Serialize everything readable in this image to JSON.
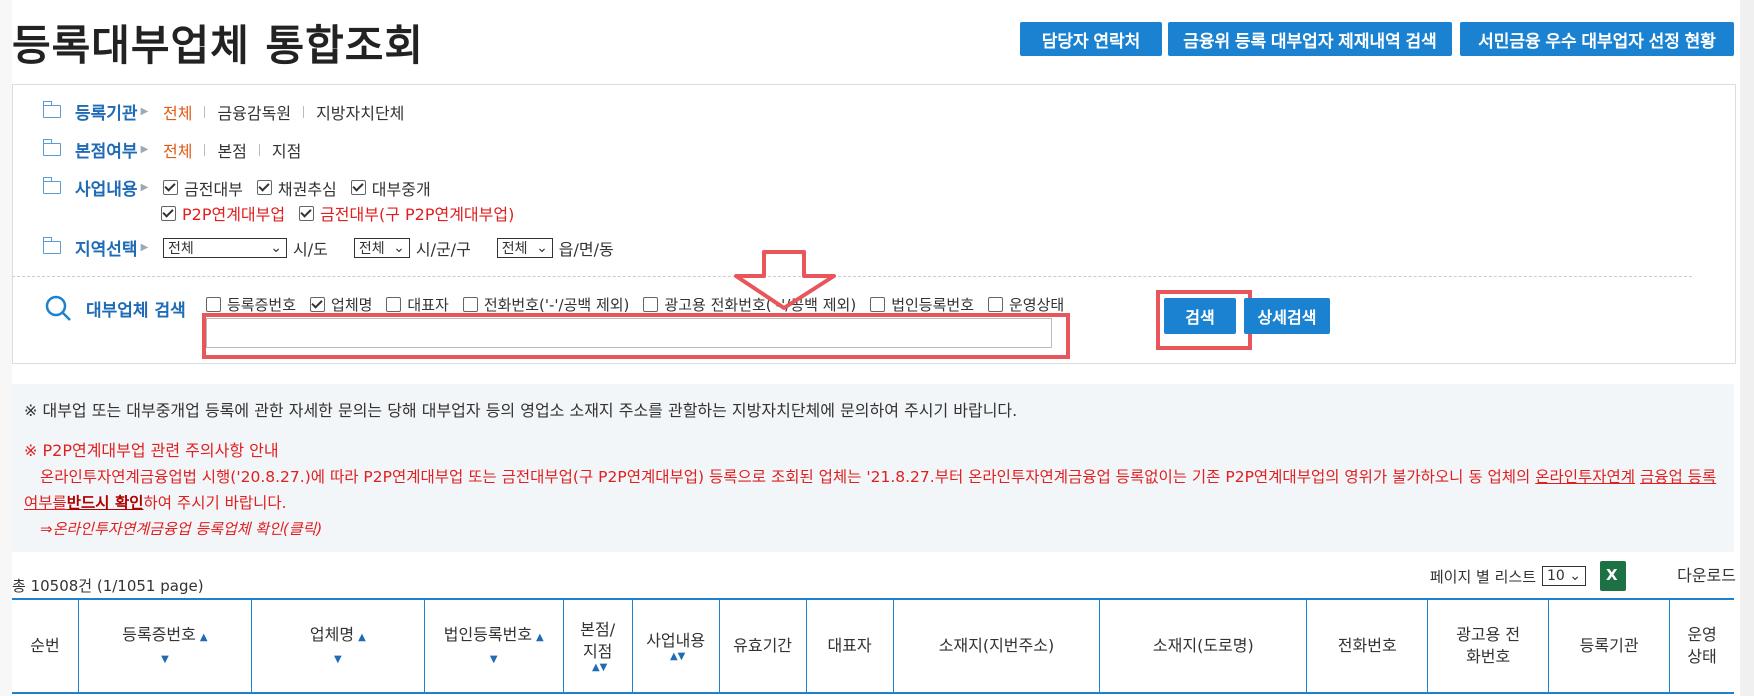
{
  "page": {
    "title": "등록대부업체 통합조회"
  },
  "top_buttons": [
    "담당자 연락처",
    "금융위 등록 대부업자 제재내역 검색",
    "서민금융 우수 대부업자 선정 현황"
  ],
  "filters": {
    "agency": {
      "label": "등록기관",
      "options": [
        "전체",
        "금융감독원",
        "지방자치단체"
      ],
      "selected": "전체"
    },
    "branch": {
      "label": "본점여부",
      "options": [
        "전체",
        "본점",
        "지점"
      ],
      "selected": "전체"
    },
    "business": {
      "label": "사업내용",
      "items": [
        {
          "label": "금전대부",
          "checked": true,
          "red": false
        },
        {
          "label": "채권추심",
          "checked": true,
          "red": false
        },
        {
          "label": "대부중개",
          "checked": true,
          "red": false
        },
        {
          "label": "P2P연계대부업",
          "checked": true,
          "red": true
        },
        {
          "label": "금전대부(구 P2P연계대부업)",
          "checked": true,
          "red": true
        }
      ]
    },
    "region": {
      "label": "지역선택",
      "sido_value": "전체",
      "sido_unit": "시/도",
      "sigungu_value": "전체",
      "sigungu_unit": "시/군/구",
      "eup_value": "전체",
      "eup_unit": "읍/면/동"
    }
  },
  "search": {
    "label": "대부업체 검색",
    "options": [
      {
        "label": "등록증번호",
        "checked": false
      },
      {
        "label": "업체명",
        "checked": true
      },
      {
        "label": "대표자",
        "checked": false
      },
      {
        "label": "전화번호('-'/공백 제외)",
        "checked": false
      },
      {
        "label": "광고용 전화번호('-'/공백 제외)",
        "checked": false
      },
      {
        "label": "법인등록번호",
        "checked": false
      },
      {
        "label": "운영상태",
        "checked": false
      }
    ],
    "input_value": "",
    "search_button": "검색",
    "detail_button": "상세검색"
  },
  "notice": {
    "line1": "※ 대부업 또는 대부중개업 등록에 관한 자세한 문의는 당해 대부업자 등의 영업소 소재지 주소를 관할하는 지방자치단체에 문의하여 주시기 바랍니다.",
    "p2p_title": "※ P2P연계대부업 관련 주의사항 안내",
    "p2p_body_a": "온라인투자연계금융업법 시행('20.8.27.)에 따라 P2P연계대부업 또는 금전대부업(구 P2P연계대부업) 등록으로 조회된 업체는 '21.8.27.부터 온라인투자연계금융업 등록없이는 기존 P2P연계대부업의 영위가 불가하오니 동 업체의",
    "p2p_link": "온라인투자연계",
    "p2p_body_b": "금융업 등록여부를",
    "p2p_bold": "반드시 확인",
    "p2p_body_c": "하여 주시기 바랍니다.",
    "p2p_check_link": "⇒온라인투자연계금융업 등록업체 확인(클릭)"
  },
  "results": {
    "total_text": "총 10508건 (1/1051 page)",
    "per_page_label": "페이지 별 리스트",
    "per_page_value": "10",
    "download_label": "다운로드"
  },
  "table": {
    "columns": [
      "순번",
      "등록증번호",
      "업체명",
      "법인등록번호",
      "본점/지점",
      "사업내용",
      "유효기간",
      "대표자",
      "소재지(지번주소)",
      "소재지(도로명)",
      "전화번호",
      "광고용 전화번호",
      "등록기관",
      "운영상태"
    ]
  },
  "colors": {
    "accent": "#1a82d0",
    "highlight": "#e8555a",
    "selected": "#e05a14"
  }
}
